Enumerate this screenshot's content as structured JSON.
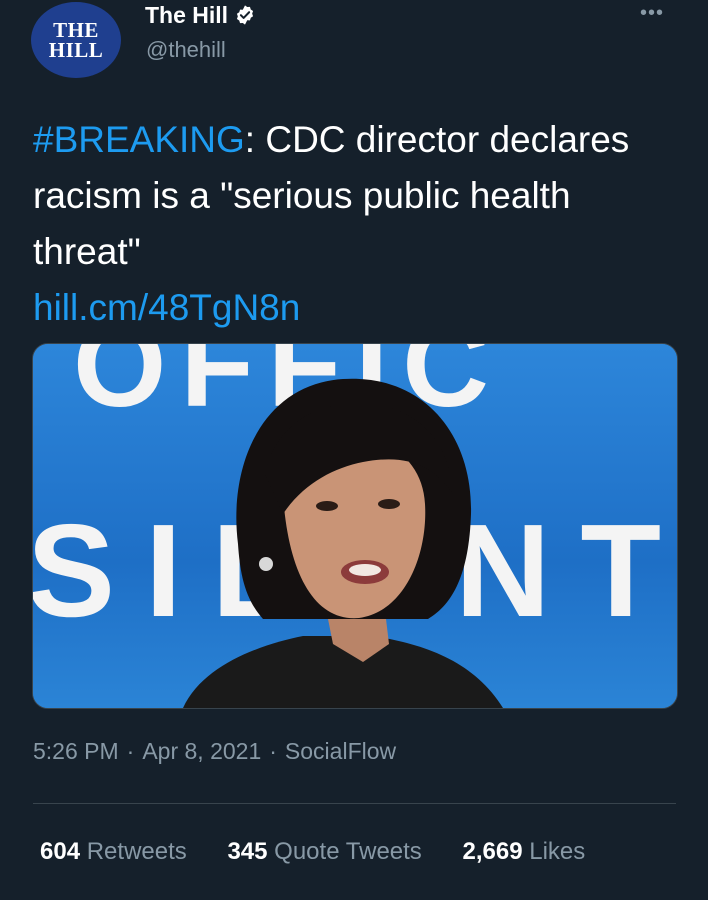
{
  "account": {
    "avatar_line1": "THE",
    "avatar_line2": "HILL",
    "display_name": "The Hill",
    "handle": "@thehill",
    "more_label": "•••"
  },
  "tweet": {
    "hashtag": "#BREAKING",
    "text": ": CDC director declares racism is a \"serious public health threat\"",
    "link": "hill.cm/48TgN8n"
  },
  "media": {
    "backdrop_text_top": "OFFIC",
    "backdrop_text_bottom": "SIDENT"
  },
  "meta": {
    "time": "5:26 PM",
    "date": "Apr 8, 2021",
    "source": "SocialFlow",
    "separator": "·"
  },
  "stats": {
    "retweets_count": "604",
    "retweets_label": "Retweets",
    "quotes_count": "345",
    "quotes_label": "Quote Tweets",
    "likes_count": "2,669",
    "likes_label": "Likes"
  },
  "colors": {
    "background": "#15202b",
    "link": "#1d9bf0",
    "secondary_text": "#8899a6",
    "divider": "#38444d"
  }
}
